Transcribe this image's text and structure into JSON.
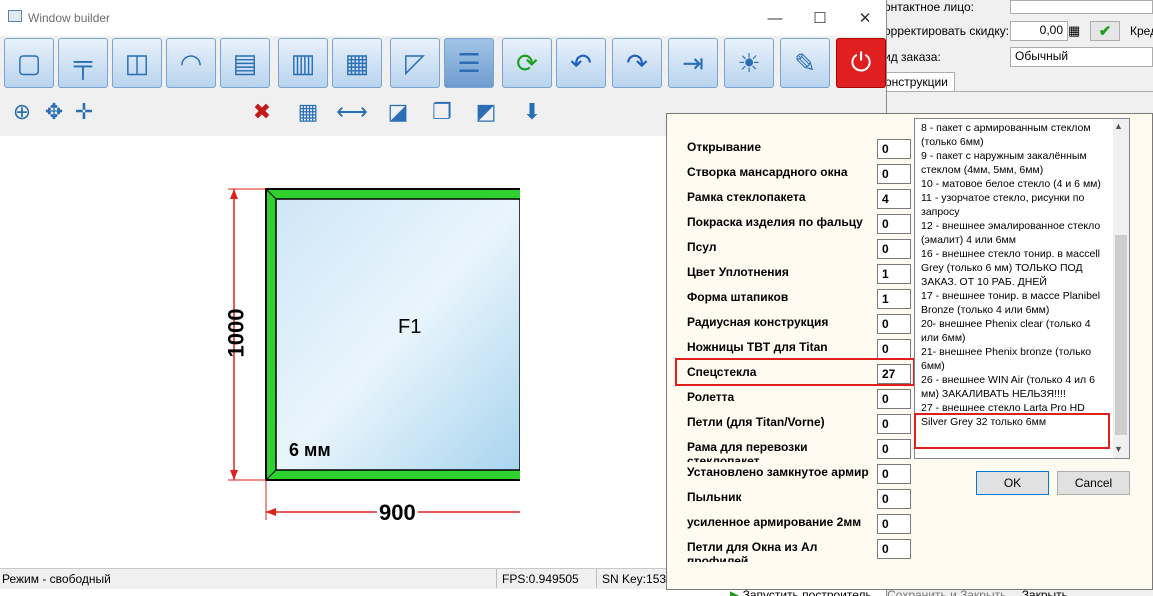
{
  "window": {
    "title": "Window builder"
  },
  "toolbar_main": [
    "window-frame-icon",
    "impost-icon",
    "sash-icon",
    "arch-icon",
    "door-icon",
    "multi-sash-icon",
    "grid-sash-icon",
    "profile-angle-icon",
    "properties-icon",
    "refresh-icon",
    "undo-icon",
    "redo-icon",
    "export-icon",
    "preview-icon",
    "paint-icon",
    "power-icon"
  ],
  "toolbar_secondary": [
    "zoom-in-icon",
    "pan-icon",
    "move-icon",
    "delete-icon",
    "grid-icon",
    "dimension-icon",
    "glass-icon",
    "copy-icon",
    "view-3d-icon",
    "save-icon"
  ],
  "drawing": {
    "label": "F1",
    "glass": "6 мм",
    "height_dim": "1000",
    "width_dim": "900",
    "frame_color": "#2fd12f"
  },
  "status": {
    "mode": "Режим - свободный",
    "fps": "FPS:0.949505",
    "sn": "SN Key:1536"
  },
  "background_app": {
    "contact_label": "онтактное лицо:",
    "discount_label": "орректировать скидку:",
    "discount_value": "0,00",
    "cred_label": "Кред",
    "order_type_label": "ид заказа:",
    "order_type_value": "Обычный",
    "tab_label": "онструкции",
    "footer_run": "Запустить построитель",
    "footer_save": "Сохранить и Закрыть",
    "footer_close": "Закрыть"
  },
  "dialog": {
    "params": [
      {
        "label": "Открывание",
        "value": "0"
      },
      {
        "label": "Створка мансардного окна",
        "value": "0"
      },
      {
        "label": "Рамка стеклопакета",
        "value": "4"
      },
      {
        "label": "Покраска изделия по фальцу",
        "value": "0"
      },
      {
        "label": "Псул",
        "value": "0"
      },
      {
        "label": "Цвет Уплотнения",
        "value": "1"
      },
      {
        "label": "Форма штапиков",
        "value": "1"
      },
      {
        "label": "Радиусная конструкция",
        "value": "0"
      },
      {
        "label": "Ножницы TBT для Titan",
        "value": "0"
      },
      {
        "label": "Спецстекла",
        "value": "27"
      },
      {
        "label": "Ролетта",
        "value": "0"
      },
      {
        "label": "Петли (для Titan/Vorne)",
        "value": "0"
      },
      {
        "label": "Рама для перевозки стеклопакет",
        "value": "0"
      },
      {
        "label": "Установлено замкнутое армир",
        "value": "0"
      },
      {
        "label": "Пыльник",
        "value": "0"
      },
      {
        "label": "усиленное армирование 2мм",
        "value": "0"
      },
      {
        "label": "Петли для Окна из Ал профилей",
        "value": "0"
      }
    ],
    "options": [
      "8 - пакет с армированным стеклом (только 6мм)",
      "9 - пакет с наружным закалённым стеклом (4мм, 5мм, 6мм)",
      "10 - матовое белое стекло (4 и 6 мм)",
      "11 - узорчатое стекло, рисунки по запросу",
      "12 - внешнее эмалированное стекло (эмалит)  4 или 6мм",
      "16 -  внешнее стекло тонир. в массеll Grey (только 6 мм) ТОЛЬКО ПОД ЗАКАЗ. ОТ 10 РАБ. ДНЕЙ",
      "17 - внешнее тонир. в массе Planibel Bronze (только 4 или 6мм)",
      "20- внешнее Phenix clear (только 4 или 6мм)",
      "21- внешнее Phenix bronze (только 6мм)",
      "26 - внешнее WIN Air (только 4 ил 6 мм) ЗАКАЛИВАТЬ НЕЛЬЗЯ!!!!",
      "27 - внешнее стекло Larta Pro HD Silver Grey 32  только 6мм"
    ],
    "ok_label": "OK",
    "cancel_label": "Cancel"
  }
}
